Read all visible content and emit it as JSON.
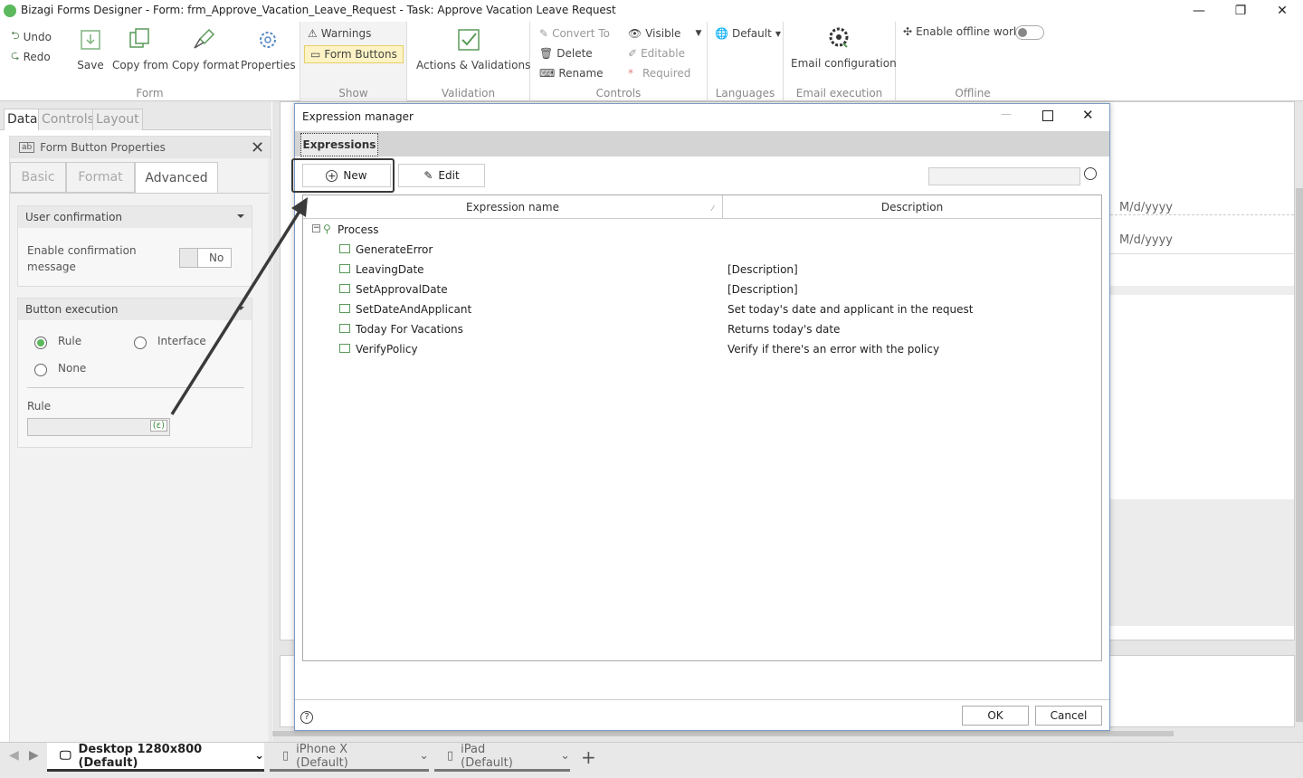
{
  "window": {
    "title": "Bizagi Forms Designer  - Form: frm_Approve_Vacation_Leave_Request - Task:  Approve Vacation Leave Request"
  },
  "ribbon": {
    "undo": "Undo",
    "redo": "Redo",
    "save": "Save",
    "copy_from": "Copy from",
    "copy_format": "Copy format",
    "properties": "Properties",
    "group_form": "Form",
    "warnings": "Warnings",
    "form_buttons": "Form Buttons",
    "group_show": "Show",
    "actions_validations": "Actions & Validations",
    "group_validation": "Validation",
    "convert_to": "Convert To",
    "delete": "Delete",
    "rename": "Rename",
    "visible": "Visible",
    "editable": "Editable",
    "required": "Required",
    "group_controls": "Controls",
    "default": "Default",
    "group_languages": "Languages",
    "email_configuration": "Email configuration",
    "group_email": "Email execution",
    "enable_offline": "Enable offline work",
    "group_offline": "Offline"
  },
  "left": {
    "tabs": [
      "Data",
      "Controls",
      "Layout"
    ],
    "panel_title": "Form Button Properties",
    "prop_tabs": [
      "Basic",
      "Format",
      "Advanced"
    ],
    "user_confirmation": "User confirmation",
    "enable_confirmation": "Enable confirmation message",
    "toggle_value": "No",
    "button_execution": "Button execution",
    "rule": "Rule",
    "interface": "Interface",
    "none": "None",
    "rule_label": "Rule"
  },
  "right": {
    "date1": "M/d/yyyy",
    "date2": "M/d/yyyy"
  },
  "dialog": {
    "title": "Expression manager",
    "tab": "Expressions",
    "new": "New",
    "edit": "Edit",
    "col_name": "Expression name",
    "col_desc": "Description",
    "root": "Process",
    "rows": [
      {
        "name": "GenerateError",
        "desc": ""
      },
      {
        "name": "LeavingDate",
        "desc": "[Description]"
      },
      {
        "name": "SetApprovalDate",
        "desc": "[Description]"
      },
      {
        "name": "SetDateAndApplicant",
        "desc": "Set today's date and applicant in the request"
      },
      {
        "name": "Today For Vacations",
        "desc": "Returns today's date"
      },
      {
        "name": "VerifyPolicy",
        "desc": "Verify if there's an error with the policy"
      }
    ],
    "ok": "OK",
    "cancel": "Cancel",
    "help": "?"
  },
  "bottom": {
    "desktop": "Desktop 1280x800 (Default)",
    "iphone": "iPhone X (Default)",
    "ipad": "iPad (Default)"
  }
}
